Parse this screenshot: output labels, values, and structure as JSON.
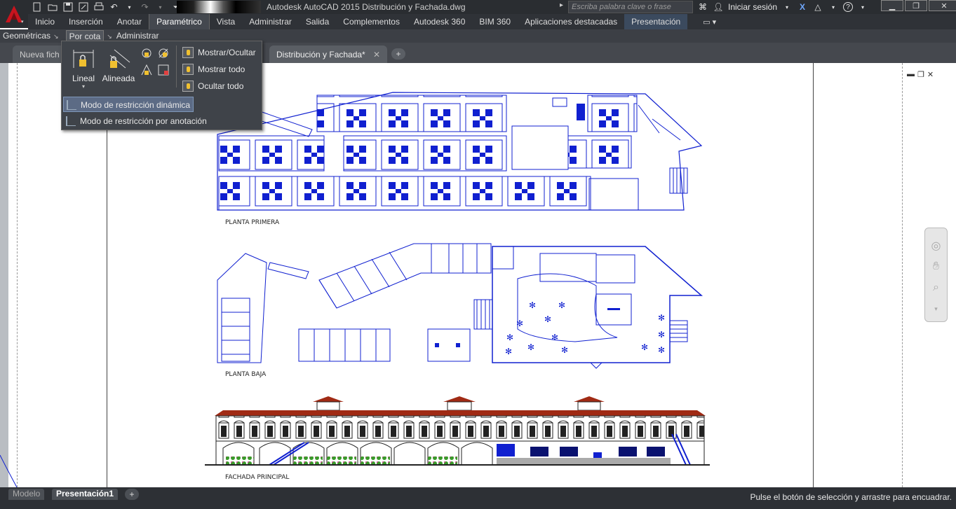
{
  "window": {
    "title": "Autodesk AutoCAD 2015    Distribución y Fachada.dwg",
    "search_placeholder": "Escriba palabra clave o frase",
    "signin": "Iniciar sesión"
  },
  "ribbon": {
    "tabs": [
      "Inicio",
      "Inserción",
      "Anotar",
      "Paramétrico",
      "Vista",
      "Administrar",
      "Salida",
      "Complementos",
      "Autodesk 360",
      "BIM 360",
      "Aplicaciones destacadas",
      "Presentación"
    ],
    "active_tab": "Paramétrico"
  },
  "panels": {
    "items": [
      "Geométricas",
      "Por cota",
      "Administrar"
    ]
  },
  "doc_tabs": {
    "new_tab": "Nueva fich",
    "current": "Distribución y Fachada*"
  },
  "dropdown": {
    "lineal": "Lineal",
    "alineada": "Alineada",
    "mostrar_ocultar": "Mostrar/Ocultar",
    "mostrar_todo": "Mostrar todo",
    "ocultar_todo": "Ocultar todo",
    "modo_dinamico": "Modo de restricción dinámica",
    "modo_anotacion": "Modo de restricción por anotación"
  },
  "drawing": {
    "labels": {
      "planta_primera": "PLANTA PRIMERA",
      "planta_baja": "PLANTA BAJA",
      "fachada": "FACHADA PRINCIPAL"
    }
  },
  "layout_tabs": [
    "Modelo",
    "Presentación1"
  ],
  "status": {
    "message": "Pulse el botón de selección y arrastre para encuadrar."
  },
  "colors": {
    "accent_red": "#c8141e",
    "drawing_blue": "#1020d0",
    "roof_red": "#a02a14"
  }
}
